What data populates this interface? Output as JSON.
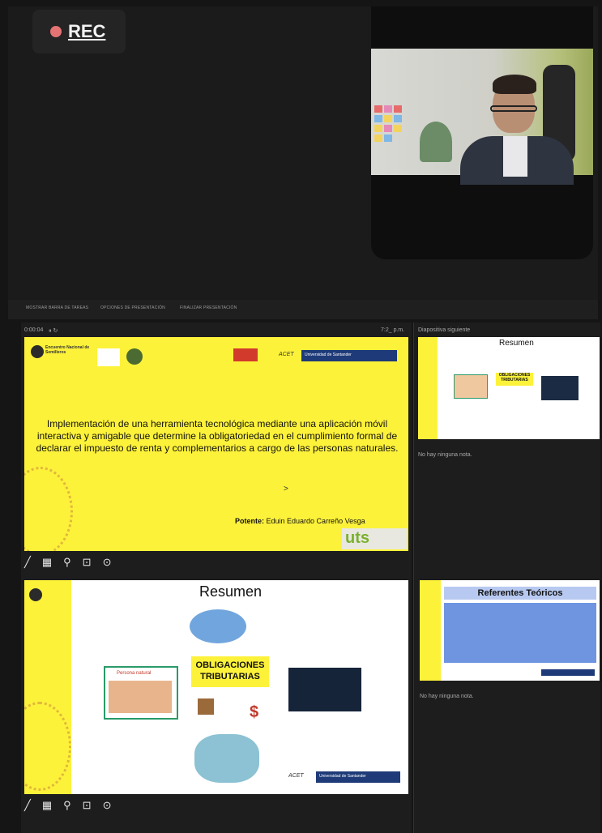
{
  "recording": {
    "label": "REC"
  },
  "toolbar_strip": {
    "items": [
      "MOSTRAR BARRA DE TAREAS",
      "OPCIONES DE PRESENTACIÓN",
      "FINALIZAR PRESENTACIÓN"
    ]
  },
  "presenter": {
    "timer": "0:00:04",
    "clock": "7:2_ p.m.",
    "next_slide_label": "Diapositiva siguiente",
    "notes_text": "No hay ninguna nota."
  },
  "current_slide": {
    "org_name": "Encuentro Nacional de Semilleros",
    "title": "Implementación de una  herramienta tecnológica  mediante una  aplicación móvil interactiva y amigable que determine la obligatoriedad en el cumplimiento formal de declarar el impuesto de renta y complementarios a cargo de las personas naturales.",
    "presenter_label": "Potente:",
    "presenter_name": "Eduin Eduardo Carreño Vesga",
    "arrow": ">",
    "uts_logo": "uts",
    "acet": "ACET",
    "univ": "Universidad de Santander"
  },
  "resumen_slide": {
    "title": "Resumen",
    "center_label": "OBLIGACIONES TRIBUTARIAS",
    "persona_label": "Persona natural",
    "acet": "ACET",
    "univ": "Universidad de Santander"
  },
  "next_slide_2": {
    "title": "Referentes Teóricos"
  },
  "tools_icons": [
    "pen-icon",
    "grid-icon",
    "magnifier-icon",
    "monitor-icon",
    "more-icon"
  ],
  "colors": {
    "slide_yellow": "#fdf23a",
    "rec_red": "#e57373",
    "ref_blue": "#b7c9f0"
  }
}
